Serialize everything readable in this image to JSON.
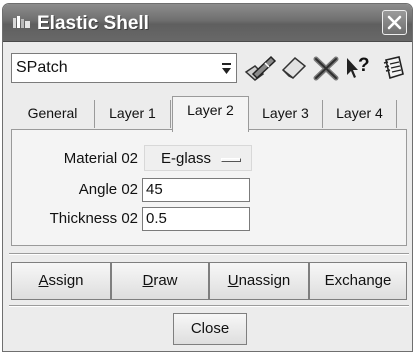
{
  "window": {
    "title": "Elastic Shell"
  },
  "toolbar": {
    "patch_value": "SPatch",
    "help_label": "?",
    "icons": [
      "dropdown-arrow-icon",
      "pencil-edit-icon",
      "eraser-icon",
      "delete-x-icon",
      "whats-this-help-icon",
      "notebook-icon"
    ]
  },
  "tabs": [
    {
      "label": "General",
      "active": false
    },
    {
      "label": "Layer 1",
      "active": false
    },
    {
      "label": "Layer 2",
      "active": true
    },
    {
      "label": "Layer 3",
      "active": false
    },
    {
      "label": "Layer 4",
      "active": false
    }
  ],
  "form": {
    "material_label": "Material 02",
    "material_value": "E-glass",
    "angle_label": "Angle 02",
    "angle_value": "45",
    "thickness_label": "Thickness 02",
    "thickness_value": "0.5"
  },
  "actions": {
    "assign_first": "A",
    "assign_rest": "ssign",
    "draw_first": "D",
    "draw_rest": "raw",
    "unassign_first": "U",
    "unassign_rest": "nassign",
    "exchange": "Exchange"
  },
  "footer": {
    "close_first": "C",
    "close_rest": "lose"
  }
}
